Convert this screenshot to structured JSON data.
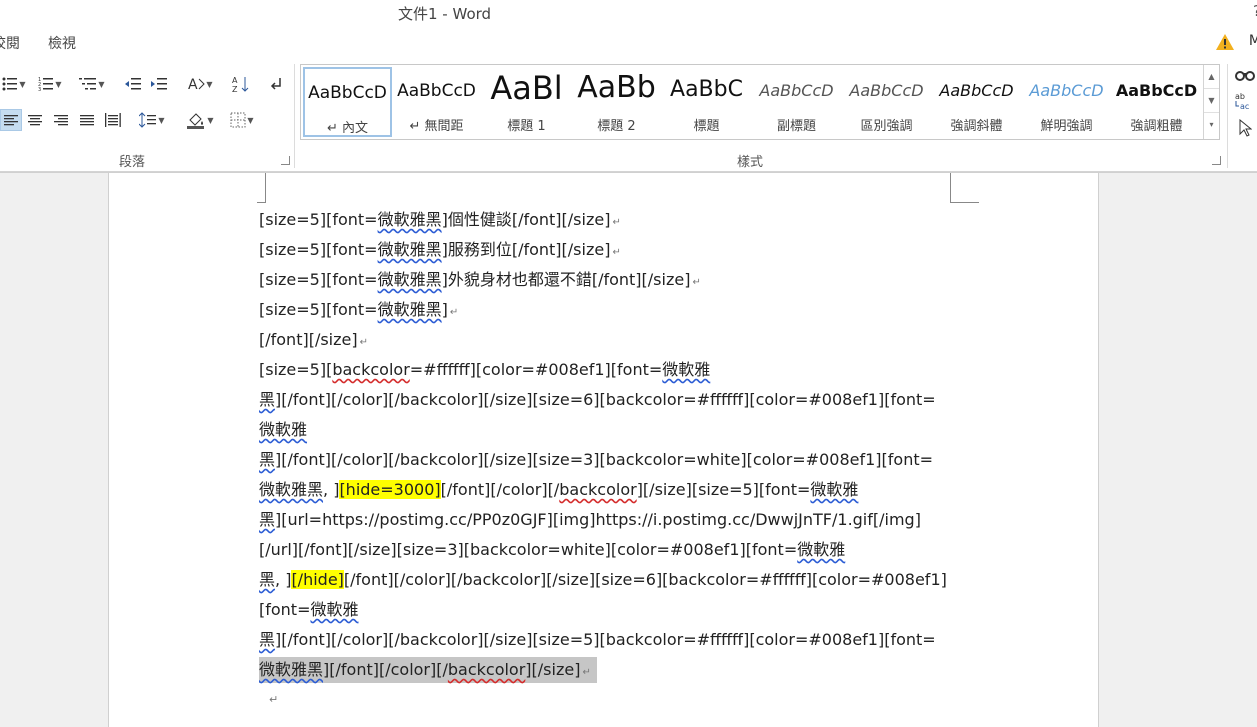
{
  "window": {
    "title": "文件1 - Word",
    "help_glyph": "?"
  },
  "tabs": [
    {
      "label": "校閱"
    },
    {
      "label": "檢視"
    }
  ],
  "account": {
    "label": "M"
  },
  "ribbon": {
    "paragraph_group": "段落",
    "styles_group": "樣式",
    "styles": [
      {
        "sample": "AaBbCcD",
        "name": "↵ 內文"
      },
      {
        "sample": "AaBbCcD",
        "name": "↵ 無間距"
      },
      {
        "sample": "AaBl",
        "name": "標題 1"
      },
      {
        "sample": "AaBb",
        "name": "標題 2"
      },
      {
        "sample": "AaBbC",
        "name": "標題"
      },
      {
        "sample": "AaBbCcD",
        "name": "副標題"
      },
      {
        "sample": "AaBbCcD",
        "name": "區別強調"
      },
      {
        "sample": "AaBbCcD",
        "name": "強調斜體"
      },
      {
        "sample": "AaBbCcD",
        "name": "鮮明強調"
      },
      {
        "sample": "AaBbCcD",
        "name": "強調粗體"
      }
    ]
  },
  "document": {
    "l1_a": "[size=5][font=",
    "l1_b": "微軟雅黑",
    "l1_c": "]個性健談[/font][/size]",
    "l2_a": "[size=5][font=",
    "l2_b": "微軟雅黑",
    "l2_c": "]服務到位[/font][/size]",
    "l3_a": "[size=5][font=",
    "l3_b": "微軟雅黑",
    "l3_c": "]外貌身材也都還不錯[/font][/size]",
    "l4_a": "[size=5][font=",
    "l4_b": "微軟雅黑",
    "l4_c": "]",
    "l5": "[/font][/size]",
    "l6_a": "[size=5][",
    "l6_b": "backcolor",
    "l6_c": "=#ffffff][color=#008ef1][font=",
    "l6_d": "微軟雅",
    "l7_a": "黑",
    "l7_b": "][/font][/color][/backcolor][/size][size=6][backcolor=#ffffff][color=#008ef1][font=",
    "l8_a": "微軟雅",
    "l9_a": "黑",
    "l9_b": "][/font][/color][/backcolor][/size][size=3][backcolor=white][color=#008ef1][font=",
    "l10_a": "微軟雅黑",
    "l10_b": ", ]",
    "l10_c": "[hide=3000]",
    "l10_d": "[/font][/color][/",
    "l10_e": "backcolor",
    "l10_f": "][/size][size=5][font=",
    "l10_g": "微軟雅",
    "l11_a": "黑",
    "l11_b": "][url=https://postimg.cc/PP0z0GJF][img]https://i.postimg.cc/DwwjJnTF/1.gif[/img]",
    "l12_a": "[/url][/font][/size][size=3][backcolor=white][color=#008ef1][font=",
    "l12_b": "微軟雅",
    "l13_a": "黑",
    "l13_b": ", ]",
    "l13_c": "[/hide]",
    "l13_d": "[/font][/color][/backcolor][/size][size=6][backcolor=#ffffff][color=#008ef1]",
    "l14_a": "[font=",
    "l14_b": "微軟雅",
    "l15_a": "黑",
    "l15_b": "][/font][/color][/backcolor][/size][size=5][backcolor=#ffffff][color=#008ef1][font=",
    "l16_a": "微軟雅黑",
    "l16_b": "][/font][/color][/",
    "l16_c": "backcolor",
    "l16_d": "][/size]",
    "para_mark": "↵"
  },
  "colors": {
    "highlight": "#ffff00",
    "selection": "#c6c6c6",
    "spell_blue": "#2b5cd4",
    "spell_red": "#d42b2b",
    "accent": "#2b579a"
  }
}
